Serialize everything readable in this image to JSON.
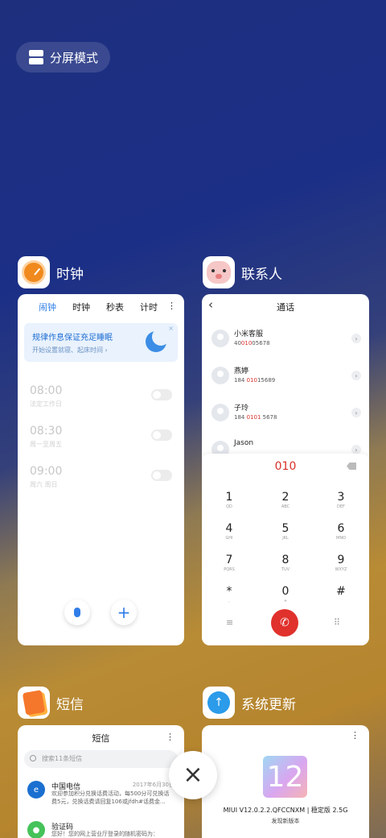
{
  "split_mode": {
    "label": "分屏模式"
  },
  "apps": {
    "clock": {
      "name": "时钟",
      "tabs": [
        "闹钟",
        "时钟",
        "秒表",
        "计时"
      ],
      "active_tab": "闹钟",
      "more": "⋮",
      "banner": {
        "title": "规律作息保证充足睡眠",
        "subtitle": "开始设置就寝、起床时间 ›",
        "close": "×"
      },
      "alarms": [
        {
          "time": "08:00",
          "label": "法定工作日",
          "enabled": false
        },
        {
          "time": "08:30",
          "label": "周一至周五",
          "enabled": false
        },
        {
          "time": "09:00",
          "label": "周六 周日",
          "enabled": false
        }
      ],
      "add_label": "+"
    },
    "contacts": {
      "name": "联系人",
      "title": "通话",
      "back": "‹",
      "list": [
        {
          "name": "小米客服",
          "num_pre": "40",
          "num_hl": "010",
          "num_post": "05678"
        },
        {
          "name": "燕婷",
          "num_pre": "184 ",
          "num_hl": "010",
          "num_post": "15689"
        },
        {
          "name": "子玲",
          "num_pre": "184 ",
          "num_hl": "0101",
          "num_post": " 5678"
        },
        {
          "name": "Jason",
          "num_pre": "",
          "num_hl": "",
          "num_post": ""
        }
      ],
      "chev": "›",
      "dial_input": "010",
      "keys": [
        {
          "d": "1",
          "l": "QD"
        },
        {
          "d": "2",
          "l": "ABC"
        },
        {
          "d": "3",
          "l": "DEF"
        },
        {
          "d": "4",
          "l": "GHI"
        },
        {
          "d": "5",
          "l": "JKL"
        },
        {
          "d": "6",
          "l": "MNO"
        },
        {
          "d": "7",
          "l": "PQRS"
        },
        {
          "d": "8",
          "l": "TUV"
        },
        {
          "d": "9",
          "l": "WXYZ"
        },
        {
          "d": "*",
          "l": ","
        },
        {
          "d": "0",
          "l": "+"
        },
        {
          "d": "#",
          "l": ""
        }
      ],
      "menu": "≡",
      "keypad": "⠿",
      "call": "✆"
    },
    "sms": {
      "name": "短信",
      "title": "短信",
      "more": "⋮",
      "search_placeholder": "搜索11条短信",
      "items": [
        {
          "sender": "中国电信",
          "date": "2017年6月30日",
          "body": "欢迎参加积分兑换话费活动，每500分可兑换话费5元，兑换话费请回复106或jfdh#话费金...",
          "color": "#1a6fd0"
        },
        {
          "sender": "验证码",
          "date": "",
          "body": "您好！您的网上营业厅登录的随机密码为：",
          "color": "#45c25a"
        }
      ]
    },
    "updater": {
      "name": "系统更新",
      "more": "⋮",
      "logo_text": "12",
      "version": "MIUI V12.0.2.2.QFCCNXM | 稳定版 2.5G",
      "subtitle": "发现新版本"
    }
  },
  "close_label": "×"
}
